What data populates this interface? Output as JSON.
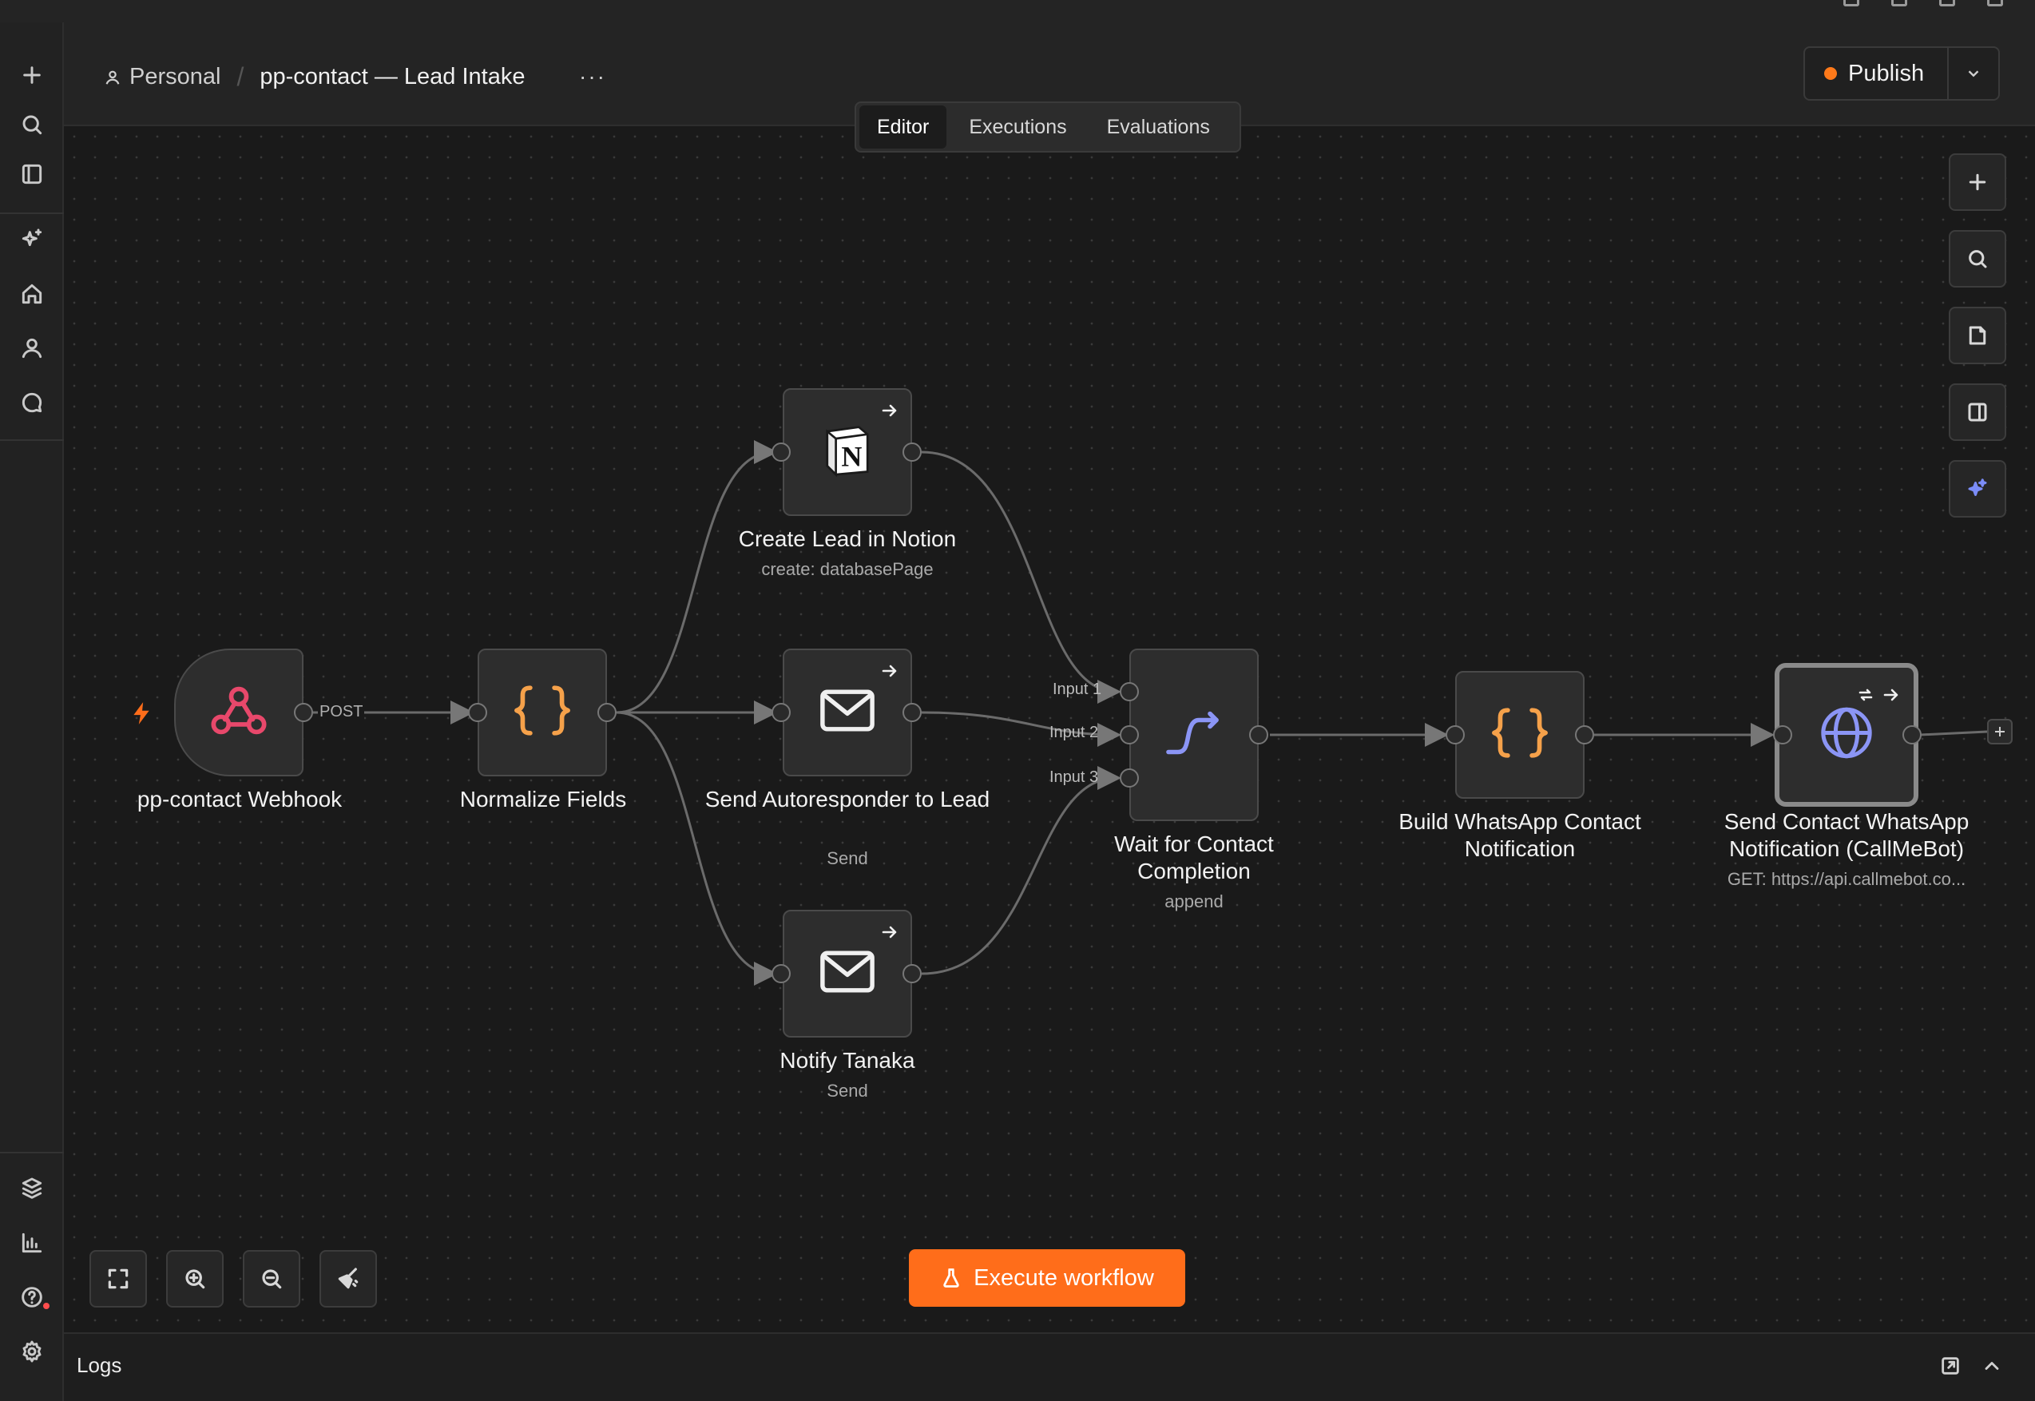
{
  "header": {
    "project": "Personal",
    "workflow_name": "pp-contact — Lead Intake",
    "more": "···",
    "publish_label": "Publish"
  },
  "tabs": [
    {
      "label": "Editor",
      "active": true
    },
    {
      "label": "Executions",
      "active": false
    },
    {
      "label": "Evaluations",
      "active": false
    }
  ],
  "nodes": {
    "webhook": {
      "label": "pp-contact Webhook",
      "icon": "webhook-icon"
    },
    "normalize": {
      "label": "Normalize Fields",
      "icon": "code-braces-icon"
    },
    "notion": {
      "label": "Create Lead in Notion",
      "sub": "create: databasePage",
      "icon": "notion-icon"
    },
    "autoresponder": {
      "label": "Send Autoresponder to Lead",
      "sub": "Send",
      "icon": "mail-icon"
    },
    "notify": {
      "label": "Notify Tanaka",
      "sub": "Send",
      "icon": "mail-icon"
    },
    "wait": {
      "label": "Wait for Contact Completion",
      "sub": "append",
      "icon": "merge-icon"
    },
    "build": {
      "label": "Build WhatsApp Contact Notification",
      "icon": "code-braces-icon"
    },
    "send": {
      "label": "Send Contact WhatsApp Notification (CallMeBot)",
      "sub": "GET: https://api.callmebot.co...",
      "icon": "globe-icon"
    }
  },
  "edge_labels": {
    "post": "POST",
    "input1": "Input 1",
    "input2": "Input 2",
    "input3": "Input 3"
  },
  "execute_label": "Execute workflow",
  "logs_label": "Logs",
  "colors": {
    "accent": "#ff6d1a",
    "webhook": "#e8486b",
    "braces": "#f5a14a",
    "merge": "#8b95f5",
    "globe": "#8b95f5",
    "ai_sparkle": "#7b8cf7"
  }
}
